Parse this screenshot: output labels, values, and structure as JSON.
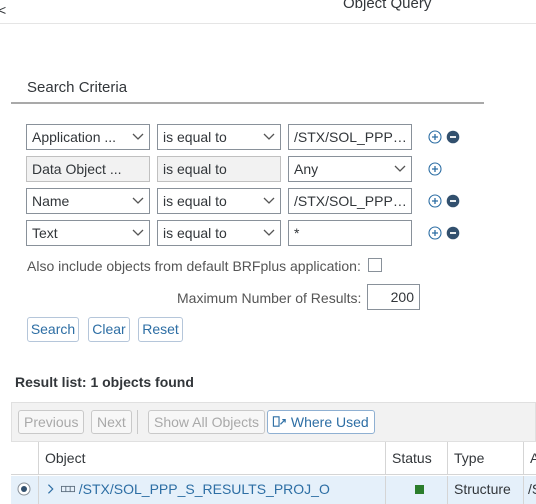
{
  "header": {
    "corner_glyph": "<",
    "title": "Object Query"
  },
  "search": {
    "title": "Search Criteria",
    "rows": [
      {
        "field": "Application ...",
        "operator": "is equal to",
        "value": "/STX/SOL_PPP_..."
      },
      {
        "field": "Data Object ...",
        "operator": "is equal to",
        "value": "Any"
      },
      {
        "field": "Name",
        "operator": "is equal to",
        "value": "/STX/SOL_PPP_..."
      },
      {
        "field": "Text",
        "operator": "is equal to",
        "value": "*"
      }
    ],
    "include_default_label": "Also include objects from default BRFplus application:",
    "include_default_checked": false,
    "max_results_label": "Maximum Number of Results:",
    "max_results_value": "200",
    "buttons": {
      "search": "Search",
      "clear": "Clear",
      "reset": "Reset"
    }
  },
  "results": {
    "summary": "Result list: 1  objects found",
    "toolbar": {
      "previous": "Previous",
      "next": "Next",
      "show_all": "Show All Objects",
      "where_used": "Where Used"
    },
    "columns": [
      "Object",
      "Status",
      "Type",
      "A"
    ],
    "rows": [
      {
        "object": "/STX/SOL_PPP_S_RESULTS_PROJ_O",
        "status_color": "#2b7d2b",
        "type": "Structure",
        "app": "/S"
      }
    ]
  },
  "colors": {
    "accent": "#2d6ea4",
    "status_active": "#2b7d2b",
    "selected_row": "#e5f0fa"
  }
}
